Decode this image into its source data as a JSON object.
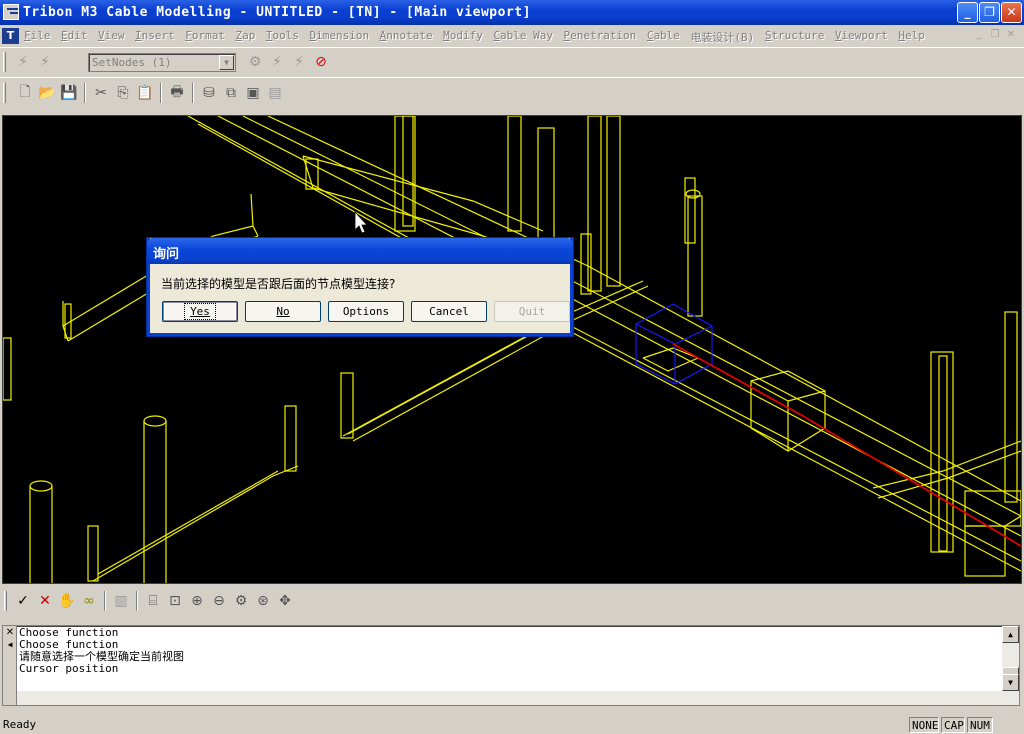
{
  "window": {
    "title": "Tribon M3 Cable Modelling - UNTITLED - [TN] - [Main viewport]",
    "minimize": "_",
    "restore": "❐",
    "close": "✕"
  },
  "menubar": {
    "doc_icon": "T",
    "items": [
      "File",
      "Edit",
      "View",
      "Insert",
      "Format",
      "Zap",
      "Tools",
      "Dimension",
      "Annotate",
      "Modify",
      "Cable Way",
      "Penetration",
      "Cable",
      "电装设计(B)",
      "Structure",
      "Viewport",
      "Help"
    ]
  },
  "toolbar1": {
    "combo_value": "SetNodes (1)"
  },
  "dialog": {
    "title": "询问",
    "message": "当前选择的模型是否跟后面的节点模型连接?",
    "buttons": {
      "yes": "Yes",
      "no": "No",
      "options": "Options",
      "cancel": "Cancel",
      "quit": "Quit"
    }
  },
  "messages": {
    "lines": [
      "Choose function",
      "Choose function",
      "请随意选择一个模型确定当前视图",
      "Cursor position"
    ]
  },
  "statusbar": {
    "text": "Ready",
    "indicators": [
      "NONE",
      "CAP",
      "NUM"
    ]
  },
  "colors": {
    "model_lines": "#f0f000",
    "selection_box": "#1818ff",
    "cable_path": "#e00000",
    "viewport_bg": "#000000"
  }
}
